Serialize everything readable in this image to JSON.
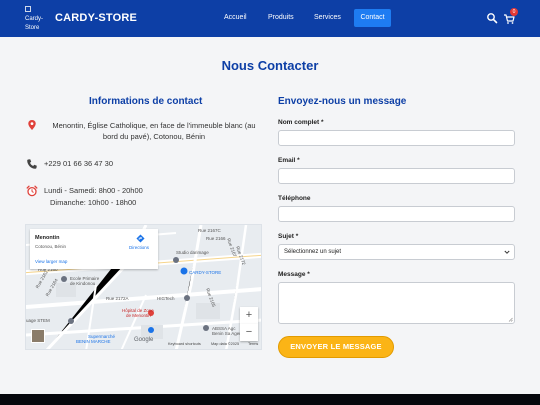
{
  "nav": {
    "logo_alt": "Cardy-Store",
    "brand": "CARDY-STORE",
    "links": [
      "Accueil",
      "Produits",
      "Services",
      "Contact"
    ],
    "active_link": "Contact",
    "cart_count": "0",
    "icons": [
      "search-icon",
      "cart-icon"
    ]
  },
  "page": {
    "title": "Nous Contacter"
  },
  "contact_info": {
    "title": "Informations de contact",
    "address": "Menontin, Église Catholique, en face de l'immeuble blanc (au bord du pavé), Cotonou, Bénin",
    "phone": "+229 01 66 36 47 30",
    "hours_line1": "Lundi - Samedi: 8h00 - 20h00",
    "hours_line2": "Dimanche: 10h00 - 18h00",
    "icons": [
      "location-pin-icon",
      "phone-icon",
      "alarm-clock-icon"
    ]
  },
  "map": {
    "place_name": "Menontin",
    "place_sub": "Cotonou, Bénin",
    "directions": "Directions",
    "view_larger": "View larger map",
    "labels": {
      "rue_2167c": "Rue 2167C",
      "rue_2166": "Rue 2166",
      "rue_2167": "Rue 2167",
      "studio_darimage": "Studio darimage",
      "rue_2172": "Rue 2172",
      "ntin": "NTIN",
      "rue_2160": "Rue 2160",
      "rue_2162": "Rue 2162",
      "ecole_primaire": "Ecole Primaire",
      "de_kindonou": "de Kindonou",
      "cardy_store": "CARDY-STORE",
      "rue_2164": "Rue 2164",
      "rue_2172a": "Rue 2172A",
      "higtech": "HIGTech",
      "hopital_1": "Hôpital de Zone",
      "hopital_2": "de Menontin",
      "rue_2165": "Rue 2165",
      "stem": "uage STEM",
      "abssa_1": "ABSSA Agc",
      "abssa_2": "Benin Sa Agence",
      "super_1": "Supermarché",
      "super_2": "BENIN MARCHE",
      "google": "Google"
    },
    "zoom_in": "+",
    "zoom_out": "−",
    "footer": [
      "Keyboard shortcuts",
      "Map data ©2025",
      "Terms"
    ]
  },
  "form": {
    "title": "Envoyez-nous un message",
    "name_label": "Nom complet",
    "email_label": "Email",
    "phone_label": "Téléphone",
    "subject_label": "Sujet",
    "subject_selected": "Sélectionnez un sujet",
    "message_label": "Message",
    "required_mark": "*",
    "submit": "ENVOYER LE MESSAGE"
  },
  "colors": {
    "navbar": "#0d3fa6",
    "accent": "#1e7cf2",
    "heading": "#0d3fa6",
    "submit": "#fbb416",
    "badge": "#e53935",
    "footer": "#06080d"
  }
}
